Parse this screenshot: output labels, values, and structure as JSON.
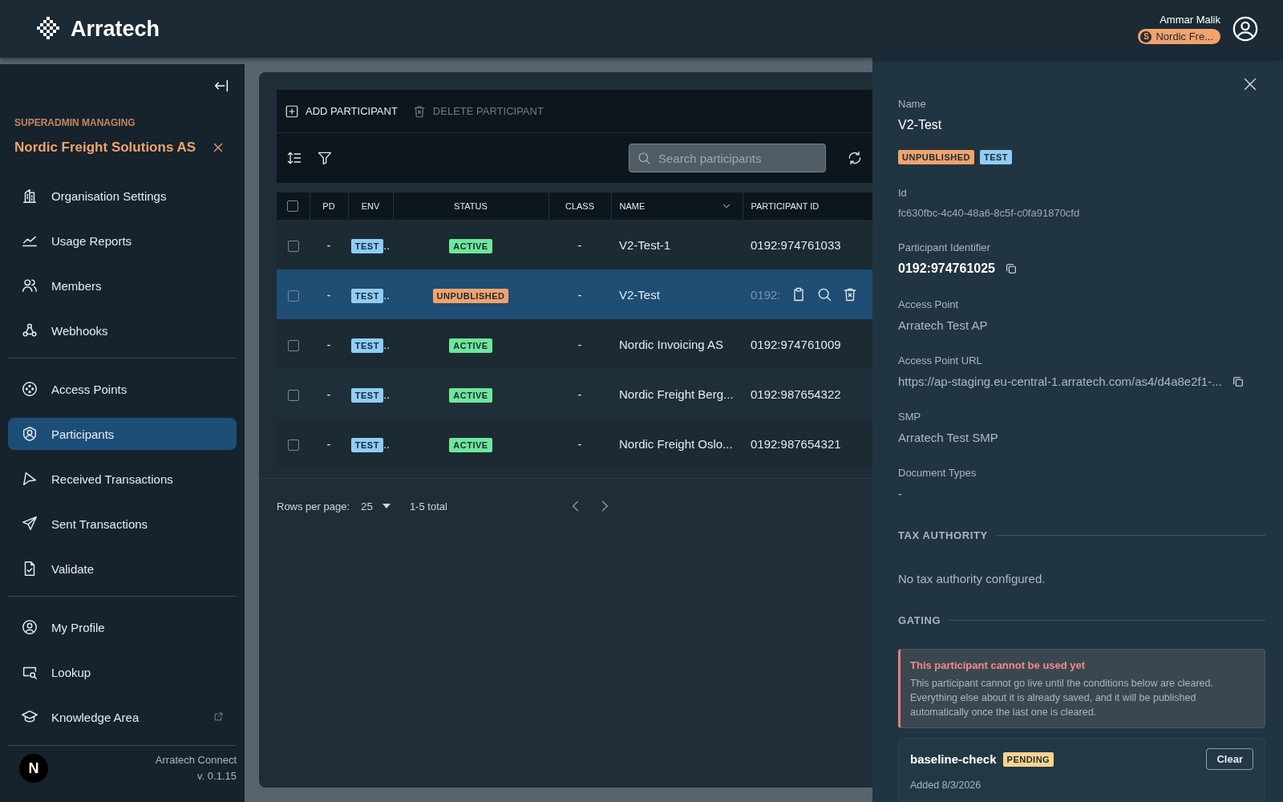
{
  "header": {
    "logo_text": "Arratech",
    "user_name": "Ammar Malik",
    "org_badge": {
      "letter": "S",
      "text": "Nordic Fre..."
    }
  },
  "sidebar": {
    "managing_label": "SUPERADMIN MANAGING",
    "org_name": "Nordic Freight Solutions AS",
    "groups": [
      [
        {
          "label": "Organisation Settings",
          "selected": false
        },
        {
          "label": "Usage Reports",
          "selected": false
        },
        {
          "label": "Members",
          "selected": false
        },
        {
          "label": "Webhooks",
          "selected": false
        }
      ],
      [
        {
          "label": "Access Points",
          "selected": false
        },
        {
          "label": "Participants",
          "selected": true
        },
        {
          "label": "Received Transactions",
          "selected": false
        },
        {
          "label": "Sent Transactions",
          "selected": false
        },
        {
          "label": "Validate",
          "selected": false
        }
      ],
      [
        {
          "label": "My Profile",
          "selected": false
        },
        {
          "label": "Lookup",
          "selected": false
        },
        {
          "label": "Knowledge Area",
          "selected": false,
          "external": true
        }
      ]
    ],
    "footer": {
      "avatar_letter": "N",
      "app_name": "Arratech Connect",
      "version": "v. 0.1.15"
    }
  },
  "toolbar": {
    "actions": [
      {
        "label": "ADD PARTICIPANT",
        "disabled": false
      },
      {
        "label": "DELETE PARTICIPANT",
        "disabled": true
      }
    ],
    "search": {
      "placeholder": "Search participants"
    }
  },
  "table": {
    "select_all": {
      "checked": false
    },
    "columns": [
      "PD",
      "ENV",
      "STATUS",
      "CLASS",
      "NAME",
      "PARTICIPANT ID"
    ],
    "rows": [
      {
        "checked": false,
        "selected": false,
        "hovered": false,
        "pd": "-",
        "env": "TEST",
        "env_more": "..",
        "status": "ACTIVE",
        "color": "#6ee79a",
        "class": "-",
        "name": "V2-Test-1",
        "participant_id": "0192:974761033"
      },
      {
        "checked": false,
        "selected": true,
        "hovered": true,
        "pd": "-",
        "env": "TEST",
        "env_more": "..",
        "status": "UNPUBLISHED",
        "color": "#f0a36e",
        "class": "-",
        "name": "V2-Test",
        "participant_id": "0192:"
      },
      {
        "checked": false,
        "selected": false,
        "hovered": false,
        "pd": "-",
        "env": "TEST",
        "env_more": "..",
        "status": "ACTIVE",
        "color": "#6ee79a",
        "class": "-",
        "name": "Nordic Invoicing AS",
        "participant_id": "0192:974761009"
      },
      {
        "checked": false,
        "selected": false,
        "hovered": false,
        "pd": "-",
        "env": "TEST",
        "env_more": "..",
        "status": "ACTIVE",
        "color": "#6ee79a",
        "class": "-",
        "name": "Nordic Freight Berg...",
        "participant_id": "0192:987654322"
      },
      {
        "checked": false,
        "selected": false,
        "hovered": false,
        "pd": "-",
        "env": "TEST",
        "env_more": "..",
        "status": "ACTIVE",
        "color": "#6ee79a",
        "class": "-",
        "name": "Nordic Freight Oslo...",
        "participant_id": "0192:987654321"
      }
    ],
    "pagination": {
      "rows_per_page_label": "Rows per page:",
      "rows_per_page": "25",
      "total": "1-5 total"
    }
  },
  "drawer": {
    "fields": [
      {
        "kind": "title",
        "label": "Name",
        "value": "V2-Test"
      },
      {
        "kind": "badges",
        "badges": [
          {
            "text": "UNPUBLISHED",
            "color": "#f0a36e"
          },
          {
            "text": "TEST",
            "color": "#90cdf4"
          }
        ]
      },
      {
        "kind": "small",
        "label": "Id",
        "value": "fc630fbc-4c40-48a6-8c5f-c0fa91870cfd"
      },
      {
        "kind": "strong-copy",
        "label": "Participant Identifier",
        "value": "0192:974761025"
      },
      {
        "kind": "plain",
        "label": "Access Point",
        "value": "Arratech Test AP"
      },
      {
        "kind": "url-copy",
        "label": "Access Point URL",
        "value": "https://ap-staging.eu-central-1.arratech.com/as4/d4a8e2f1-..."
      },
      {
        "kind": "plain",
        "label": "SMP",
        "value": "Arratech Test SMP"
      },
      {
        "kind": "plain",
        "label": "Document Types",
        "value": "-"
      }
    ],
    "tax_authority": {
      "title": "TAX AUTHORITY",
      "message": "No tax authority configured."
    },
    "gating": {
      "title": "GATING",
      "alert": {
        "title": "This participant cannot be used yet",
        "body": "This participant cannot go live until the conditions below are cleared. Everything else about it is already saved, and it will be published automatically once the last one is cleared."
      },
      "items": [
        {
          "name": "baseline-check",
          "status": "PENDING",
          "added": "Added 8/3/2026",
          "button": "Clear"
        }
      ]
    }
  }
}
